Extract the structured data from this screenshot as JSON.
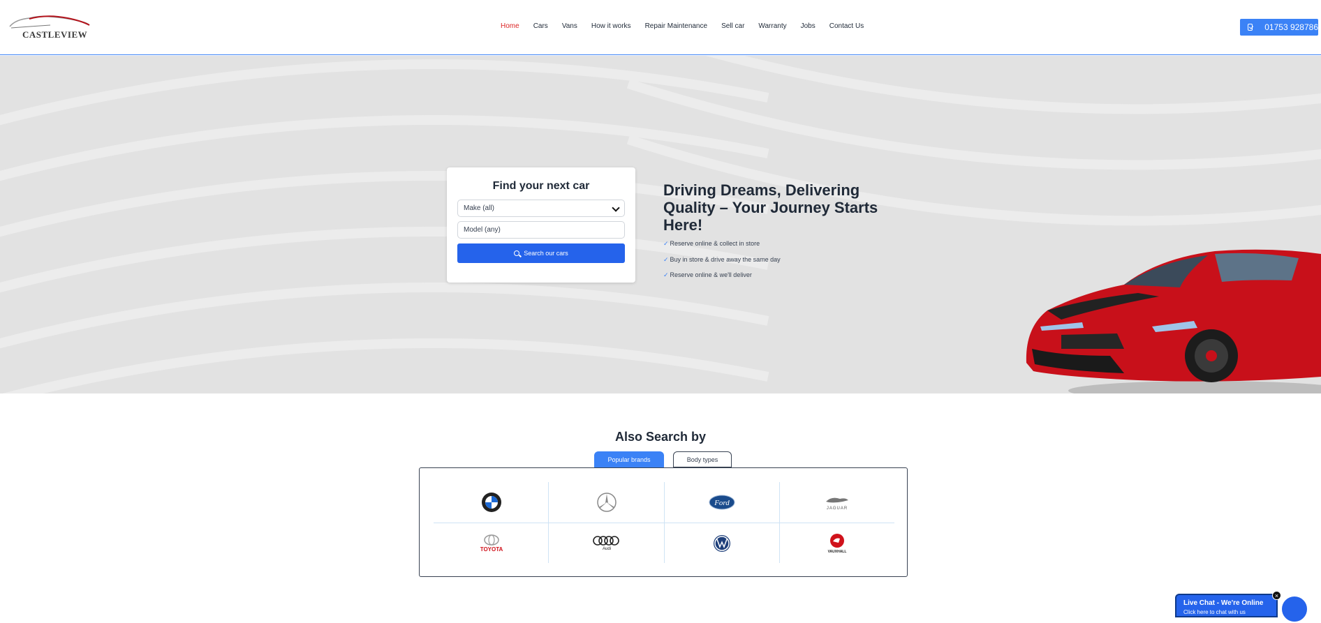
{
  "header": {
    "logo_text": "CASTLEVIEW",
    "nav": [
      {
        "label": "Home",
        "active": true
      },
      {
        "label": "Cars",
        "active": false
      },
      {
        "label": "Vans",
        "active": false
      },
      {
        "label": "How it works",
        "active": false
      },
      {
        "label": "Repair Maintenance",
        "active": false
      },
      {
        "label": "Sell car",
        "active": false
      },
      {
        "label": "Warranty",
        "active": false
      },
      {
        "label": "Jobs",
        "active": false
      },
      {
        "label": "Contact Us",
        "active": false
      }
    ],
    "phone": "01753 928786"
  },
  "hero": {
    "search": {
      "title": "Find your next car",
      "make_value": "Make (all)",
      "model_placeholder": "Model (any)",
      "button_label": "Search our cars"
    },
    "heading": "Driving Dreams, Delivering Quality – Your Journey Starts Here!",
    "features": [
      "Reserve online & collect in store",
      "Buy in store & drive away the same day",
      "Reserve online & we'll deliver"
    ]
  },
  "also_search": {
    "title": "Also Search by",
    "tabs": [
      {
        "label": "Popular brands",
        "active": true
      },
      {
        "label": "Body types",
        "active": false
      }
    ],
    "brands": [
      {
        "name": "BMW",
        "icon": "bmw-logo"
      },
      {
        "name": "Mercedes",
        "icon": "mercedes-logo"
      },
      {
        "name": "Ford",
        "icon": "ford-logo"
      },
      {
        "name": "JAGUAR",
        "icon": "jaguar-logo"
      },
      {
        "name": "TOYOTA",
        "icon": "toyota-logo"
      },
      {
        "name": "Audi",
        "icon": "audi-logo"
      },
      {
        "name": "Volkswagen",
        "icon": "vw-logo"
      },
      {
        "name": "VAUXHALL",
        "icon": "vauxhall-logo"
      }
    ]
  },
  "chat": {
    "title": "Live Chat - We're Online",
    "subtitle": "Click here to chat with us",
    "close": "×"
  },
  "colors": {
    "accent": "#3b82f6",
    "button_blue": "#2563eb",
    "active_nav": "#dc2626",
    "hero_bg": "#e2e2e2",
    "car_red": "#d0121b"
  }
}
